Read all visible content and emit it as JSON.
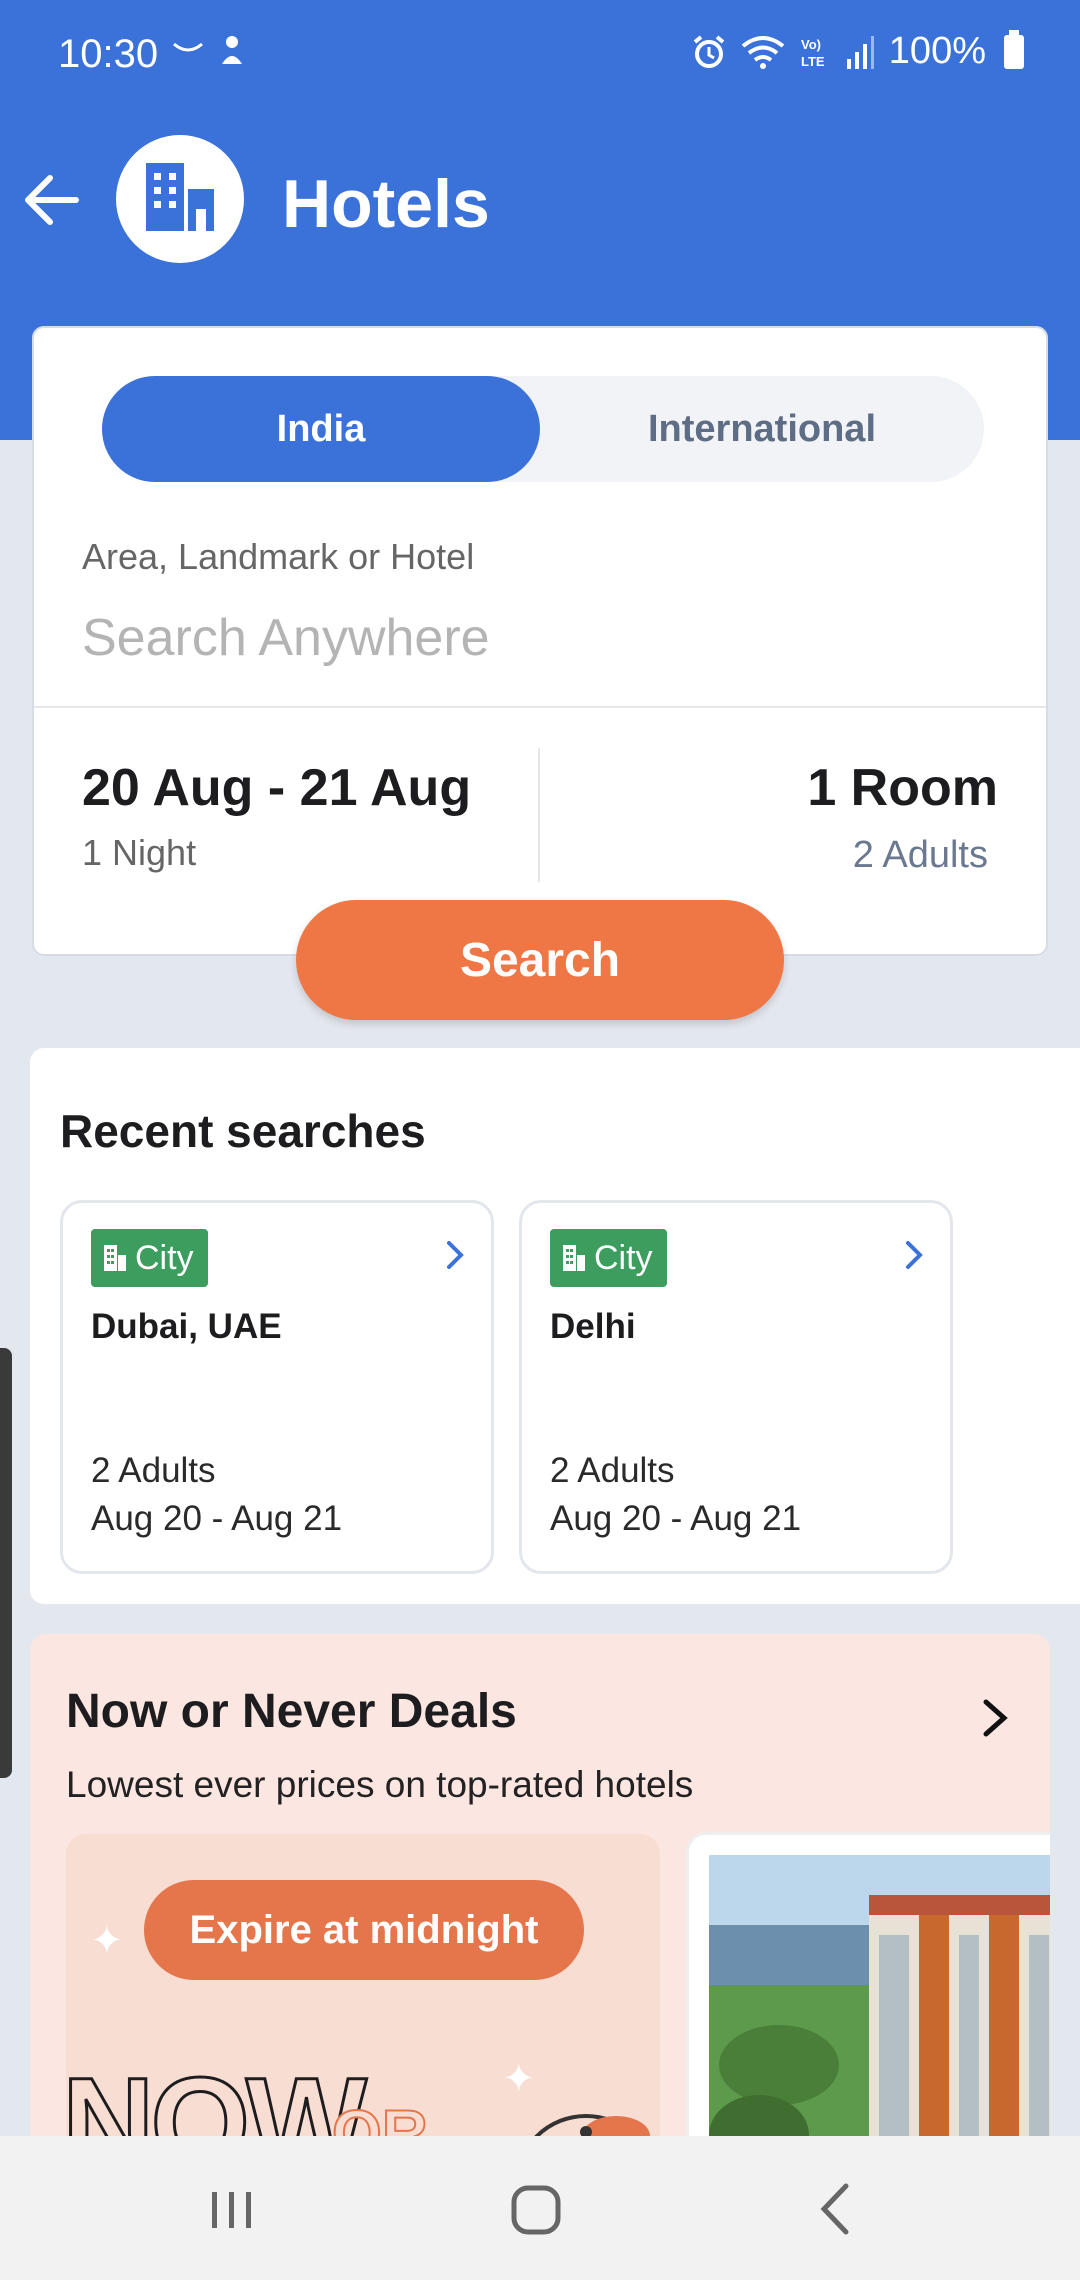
{
  "status_bar": {
    "time": "10:30",
    "battery": "100%"
  },
  "header": {
    "title": "Hotels"
  },
  "search_card": {
    "tabs": {
      "india": "India",
      "international": "International",
      "selected": "India"
    },
    "location_label": "Area, Landmark or Hotel",
    "location_placeholder": "Search Anywhere",
    "dates": "20 Aug - 21 Aug",
    "nights": "1 Night",
    "rooms": "1 Room",
    "guests": "2 Adults",
    "search_button": "Search"
  },
  "recent_searches": {
    "title": "Recent searches",
    "items": [
      {
        "badge": "City",
        "name": "Dubai, UAE",
        "guests": "2 Adults",
        "dates": "Aug 20 - Aug 21"
      },
      {
        "badge": "City",
        "name": "Delhi",
        "guests": "2 Adults",
        "dates": "Aug 20 - Aug 21"
      }
    ]
  },
  "deals": {
    "title": "Now or Never Deals",
    "subtitle": "Lowest ever prices on top-rated hotels",
    "promo_button": "Expire at midnight",
    "promo_word_1": "NOW",
    "promo_word_2": "OR"
  },
  "colors": {
    "primary": "#3b72d9",
    "accent": "#ee7745",
    "badge_green": "#3c9d5f",
    "deals_bg": "#fbe6e1"
  }
}
